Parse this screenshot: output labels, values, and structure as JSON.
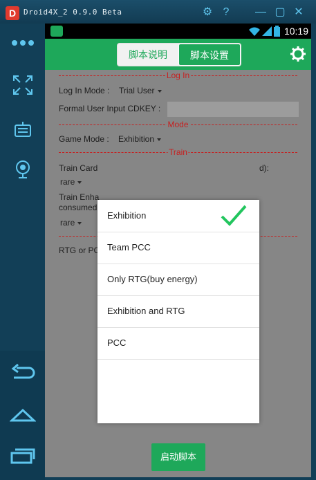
{
  "window": {
    "title": "Droid4X_2 0.9.0 Beta",
    "logo": "D",
    "controls": {
      "settings": "⚙",
      "help": "?",
      "minimize": "—",
      "maximize": "▢",
      "close": "✕"
    }
  },
  "status_bar": {
    "time": "10:19"
  },
  "app_bar": {
    "tabs": [
      "脚本说明",
      "脚本设置"
    ],
    "active_tab": 1
  },
  "form": {
    "login_section": "Log In",
    "login_mode_label": "Log In Mode :",
    "login_mode_value": "Trial User",
    "cdkey_label": "Formal User Input CDKEY :",
    "mode_section": "Mode",
    "game_mode_label": "Game Mode :",
    "game_mode_value": "Exhibition",
    "train_section": "Train",
    "train_card_label": "Train Card",
    "train_card_suffix": "d):",
    "rare_1": "rare",
    "train_enha_label": "Train Enha",
    "consumed_label": "consumed",
    "rare_2": "rare",
    "rtg_label": "RTG or PC",
    "start_button": "启动脚本"
  },
  "dialog": {
    "options": [
      "Exhibition",
      "Team PCC",
      "Only RTG(buy energy)",
      "Exhibition and RTG",
      "PCC"
    ],
    "selected_index": 0
  },
  "colors": {
    "accent_green": "#1ea85a",
    "separator_red": "#c62020",
    "emulator_blue": "#123f57",
    "icon_cyan": "#5fc6ee"
  },
  "icons": [
    "more-icon",
    "fullscreen-icon",
    "keyboard-icon",
    "webcam-icon",
    "back-icon",
    "home-icon",
    "recents-icon",
    "gear-icon",
    "wifi-icon",
    "signal-icon",
    "battery-icon",
    "check-icon"
  ]
}
